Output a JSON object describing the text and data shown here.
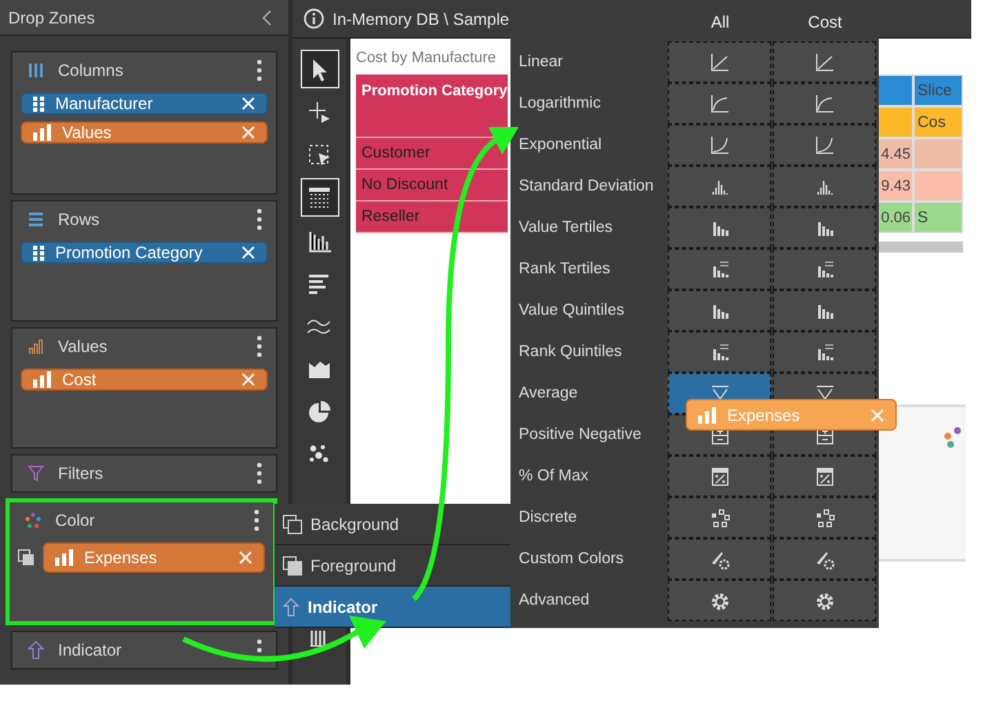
{
  "drop_zones": {
    "title": "Drop Zones",
    "zones": [
      {
        "kind": "columns",
        "label": "Columns",
        "highlighted": false,
        "fields": [
          {
            "label": "Manufacturer",
            "kind": "dimension"
          },
          {
            "label": "Values",
            "kind": "measure"
          }
        ]
      },
      {
        "kind": "rows",
        "label": "Rows",
        "highlighted": false,
        "fields": [
          {
            "label": "Promotion Category",
            "kind": "dimension"
          }
        ]
      },
      {
        "kind": "values",
        "label": "Values",
        "highlighted": false,
        "fields": [
          {
            "label": "Cost",
            "kind": "measure"
          }
        ]
      },
      {
        "kind": "filters",
        "label": "Filters",
        "highlighted": false
      },
      {
        "kind": "color",
        "label": "Color",
        "highlighted": true,
        "fields": [
          {
            "label": "Expenses",
            "kind": "measure"
          }
        ]
      },
      {
        "kind": "indicator",
        "label": "Indicator",
        "highlighted": false
      }
    ]
  },
  "document": {
    "title": "In-Memory DB \\ Sample"
  },
  "toolbar": [
    {
      "kind": "pointer",
      "selected": true
    },
    {
      "kind": "crosshair",
      "selected": false
    },
    {
      "kind": "marquee",
      "selected": false
    },
    {
      "kind": "table",
      "selected": true
    },
    {
      "kind": "columns",
      "selected": false
    },
    {
      "kind": "bars",
      "selected": false
    },
    {
      "kind": "line",
      "selected": false
    },
    {
      "kind": "area",
      "selected": false
    },
    {
      "kind": "pie",
      "selected": false
    },
    {
      "kind": "scatter",
      "selected": false
    },
    {
      "kind": "histogram",
      "selected": false
    }
  ],
  "report": {
    "title": "Cost by Manufacture",
    "table": {
      "header": "Promotion Category",
      "rows": [
        "Customer",
        "No Discount",
        "Reseller"
      ]
    },
    "value_rows": [
      {
        "cells": [
          {
            "color": "#2a8ad4"
          },
          {
            "color": "#2a8ad4",
            "text": "Slice"
          }
        ]
      },
      {
        "cells": [
          {
            "color": "#fbb829"
          },
          {
            "color": "#fbb829",
            "text": "Cos"
          }
        ]
      },
      {
        "cells": [
          {
            "color": "#efbca8",
            "text": "4.45"
          },
          {
            "color": "#efbca8"
          }
        ]
      },
      {
        "cells": [
          {
            "color": "#fcbcaa",
            "text": "9.43"
          },
          {
            "color": "#fcbcaa"
          }
        ]
      },
      {
        "cells": [
          {
            "color": "#9cd98e",
            "text": "0.06"
          },
          {
            "color": "#9cd98e",
            "text": "S"
          }
        ]
      }
    ]
  },
  "color_menu": {
    "columns": [
      "All",
      "Cost"
    ],
    "rows": [
      {
        "label": "Linear",
        "kind": "linear",
        "cells": [
          {
            "selected": false
          },
          {
            "selected": false
          }
        ]
      },
      {
        "label": "Logarithmic",
        "kind": "logarithmic",
        "cells": [
          {
            "selected": false
          },
          {
            "selected": false
          }
        ]
      },
      {
        "label": "Exponential",
        "kind": "exponential",
        "cells": [
          {
            "selected": false
          },
          {
            "selected": false
          }
        ]
      },
      {
        "label": "Standard Deviation",
        "kind": "deviation",
        "cells": [
          {
            "selected": false
          },
          {
            "selected": false
          }
        ]
      },
      {
        "label": "Value Tertiles",
        "kind": "tiles",
        "cells": [
          {
            "selected": false
          },
          {
            "selected": false
          }
        ]
      },
      {
        "label": "Rank Tertiles",
        "kind": "rank",
        "cells": [
          {
            "selected": false
          },
          {
            "selected": false
          }
        ]
      },
      {
        "label": "Value Quintiles",
        "kind": "tiles",
        "cells": [
          {
            "selected": false
          },
          {
            "selected": false
          }
        ]
      },
      {
        "label": "Rank Quintiles",
        "kind": "rank",
        "cells": [
          {
            "selected": false
          },
          {
            "selected": false
          }
        ]
      },
      {
        "label": "Average",
        "kind": "average",
        "cells": [
          {
            "selected": true
          },
          {
            "selected": false
          }
        ]
      },
      {
        "label": "Positive Negative",
        "kind": "posneg",
        "cells": [
          {
            "selected": false
          },
          {
            "selected": false
          }
        ]
      },
      {
        "label": "% Of Max",
        "kind": "percent",
        "cells": [
          {
            "selected": false
          },
          {
            "selected": false
          }
        ]
      },
      {
        "label": "Discrete",
        "kind": "discrete",
        "cells": [
          {
            "selected": false
          },
          {
            "selected": false
          }
        ]
      },
      {
        "label": "Custom Colors",
        "kind": "custom",
        "cells": [
          {
            "selected": false
          },
          {
            "selected": false
          }
        ]
      },
      {
        "label": "Advanced",
        "kind": "advanced",
        "cells": [
          {
            "selected": false
          },
          {
            "selected": false
          }
        ]
      }
    ]
  },
  "color_submenu": [
    {
      "label": "Background",
      "kind": "background",
      "selected": false
    },
    {
      "label": "Foreground",
      "kind": "foreground",
      "selected": false
    },
    {
      "label": "Indicator",
      "kind": "indicator",
      "selected": true
    }
  ],
  "drag_chip": {
    "label": "Expenses",
    "kind": "measure"
  }
}
